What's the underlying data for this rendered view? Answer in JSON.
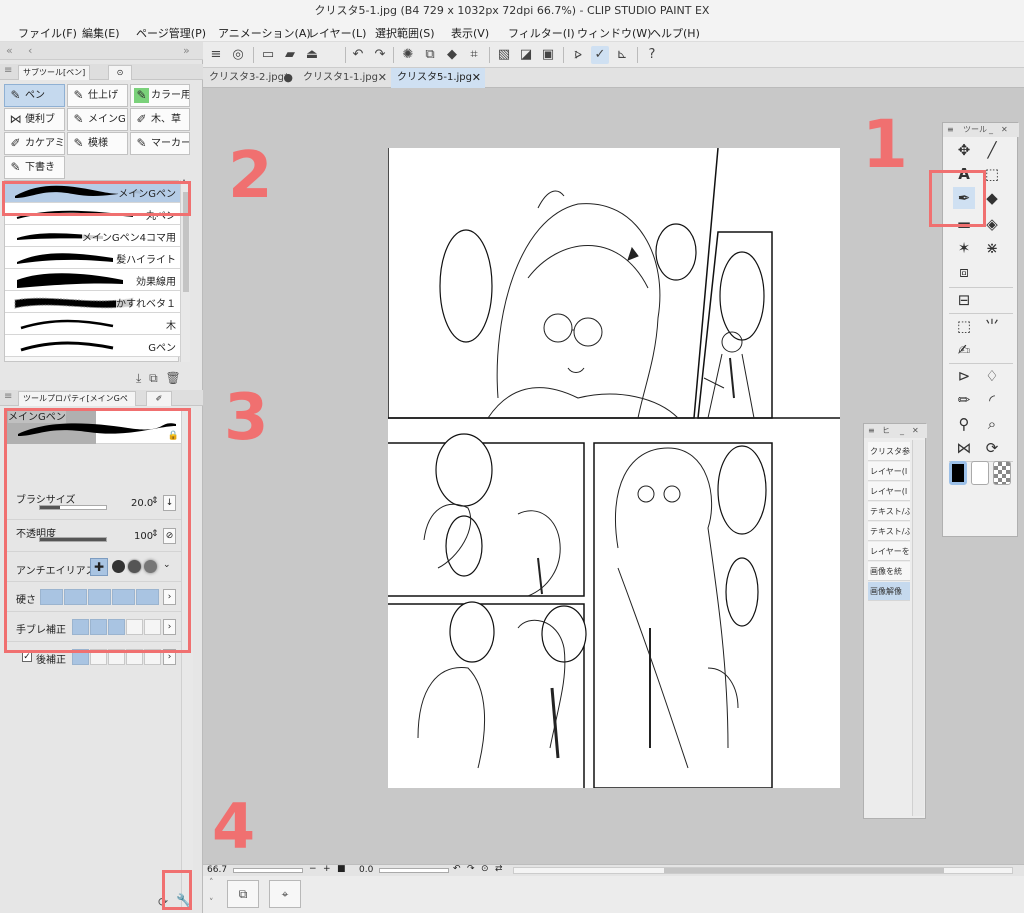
{
  "window": {
    "title": "クリスタ5-1.jpg (B4 729 x 1032px 72dpi 66.7%)  - CLIP STUDIO PAINT EX"
  },
  "menu": [
    "ファイル(F)",
    "編集(E)",
    "ページ管理(P)",
    "アニメーション(A)",
    "レイヤー(L)",
    "選択範囲(S)",
    "表示(V)",
    "フィルター(I)",
    "ウィンドウ(W)",
    "ヘルプ(H)"
  ],
  "doc_tabs": [
    {
      "label": "クリスタ3-2.jpg*",
      "close": "●"
    },
    {
      "label": "クリスタ1-1.jpg",
      "close": "✕"
    },
    {
      "label": "クリスタ5-1.jpg",
      "close": "✕"
    }
  ],
  "subtool_panel": {
    "tab_label": "サブツール[ペン]",
    "groups": [
      "ペン",
      "仕上げ",
      "カラー用",
      "便利ブ",
      "メインG",
      "木、草",
      "カケアミ",
      "模様",
      "マーカー",
      "下書き"
    ],
    "brushes": [
      "メインGペン",
      "丸ペン",
      "メインGペン4コマ用",
      "髪ハイライト",
      "効果線用",
      "かすれベタ１",
      "木",
      "Gペン"
    ]
  },
  "tool_property": {
    "tab_label": "ツールプロパティ[メインGペン]",
    "preset_name": "メインGペン",
    "brush_size_label": "ブラシサイズ",
    "brush_size_value": "20.0",
    "brush_size_fraction": 0.3,
    "opacity_label": "不透明度",
    "opacity_value": "100",
    "opacity_fraction": 1.0,
    "antialias_label": "アンチエイリアス",
    "hardness_label": "硬さ",
    "hardness_level": 5,
    "stabilization_label": "手ブレ補正",
    "stabilization_level": 3,
    "post_correction_label": "後補正",
    "post_correction_checked": true,
    "post_correction_level": 1
  },
  "tool_palette": {
    "title": "ツール"
  },
  "layer_mini_panel": {
    "title": "ヒ",
    "items": [
      "クリスタ参",
      "レイヤー(I",
      "レイヤー(I",
      "テキスト/ぶ",
      "テキスト/ぶ",
      "レイヤーを",
      "画像を統",
      "画像解像"
    ]
  },
  "status": {
    "zoom": "66.7",
    "angle": "0.0"
  },
  "annotations": [
    "1",
    "2",
    "3",
    "4"
  ],
  "colors": {
    "annotation_red": "#f07070",
    "selection_blue": "#b5cce6"
  }
}
